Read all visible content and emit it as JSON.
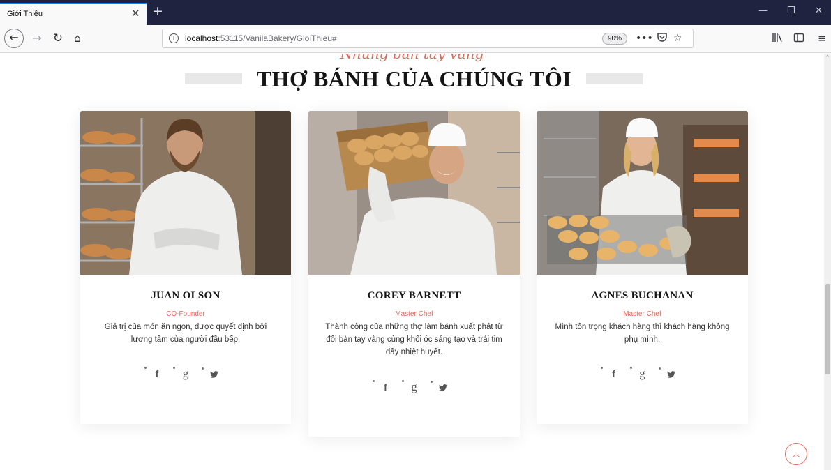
{
  "browser": {
    "tab_title": "Giới Thiệu",
    "tab_close": "✕",
    "new_tab": "+",
    "url_host": "localhost",
    "url_rest": ":53115/VanilaBakery/GioiThieu#",
    "zoom": "90%",
    "win_minimize": "—",
    "win_restore": "❐",
    "win_close": "✕"
  },
  "section": {
    "subtitle": "Những bàn tay vàng",
    "title": "THỢ BÁNH CỦA CHÚNG TÔI"
  },
  "chefs": [
    {
      "name": "JUAN OLSON",
      "role": "CO-Founder",
      "description": "Giá trị của món ăn ngon, được quyết định bởi lương tâm của người đầu bếp."
    },
    {
      "name": "COREY BARNETT",
      "role": "Master Chef",
      "description": "Thành công của những thợ làm bánh xuất phát từ đôi bàn tay vàng cùng khối óc sáng tạo và trái tim đầy nhiệt huyết."
    },
    {
      "name": "AGNES BUCHANAN",
      "role": "Master Chef",
      "description": "Mình tôn trọng khách hàng thì khách hàng không phụ mình."
    }
  ],
  "social_icons": [
    "facebook-icon",
    "google-plus-icon",
    "twitter-icon"
  ],
  "colors": {
    "accent": "#e06a5a",
    "tabbar": "#202340",
    "title": "#151515"
  }
}
